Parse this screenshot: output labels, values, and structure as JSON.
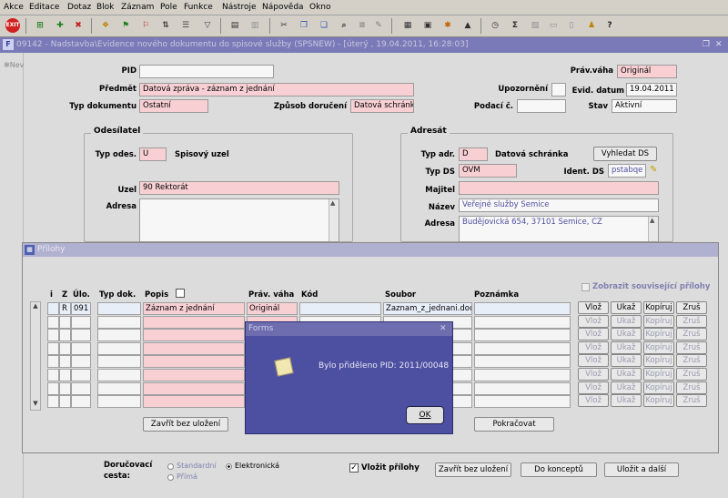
{
  "menu": [
    "Akce",
    "Editace",
    "Dotaz",
    "Blok",
    "Záznam",
    "Pole",
    "Funkce",
    "Nástroje",
    "Nápověda",
    "Okno"
  ],
  "window": {
    "title": "09142 - Nadstavba\\Evidence nového dokumentu do spisové služby (SPSNEW) - [úterý  , 19.04.2011, 16:28:03]"
  },
  "left_label": "Nev",
  "main": {
    "pid_label": "PID",
    "pid_value": "",
    "predmet_label": "Předmět",
    "predmet_value": "Datová zpráva - záznam z jednání",
    "typdok_label": "Typ dokumentu",
    "typdok_value": "Ostatní",
    "zpusob_label": "Způsob doručení",
    "zpusob_value": "Datová schránka",
    "prav_label": "Práv.váha",
    "prav_value": "Originál",
    "upoz_label": "Upozornění",
    "evid_label": "Evid. datum",
    "evid_value": "19.04.2011",
    "podaci_label": "Podací č.",
    "podaci_value": "",
    "stav_label": "Stav",
    "stav_value": "Aktivní"
  },
  "odesilatel": {
    "title": "Odesílatel",
    "typodes_label": "Typ odes.",
    "typodes_value": "U",
    "typodes_desc": "Spisový uzel",
    "uzel_label": "Uzel",
    "uzel_value": "90 Rektorát",
    "adresa_label": "Adresa",
    "adresa_value": ""
  },
  "adresat": {
    "title": "Adresát",
    "typadr_label": "Typ adr.",
    "typadr_value": "D",
    "typadr_desc": "Datová schránka",
    "vyhledat_label": "Vyhledat DS",
    "typds_label": "Typ DS",
    "typds_value": "OVM",
    "ident_label": "Ident. DS",
    "ident_value": "pstabqe",
    "majitel_label": "Majitel",
    "majitel_value": "",
    "nazev_label": "Název",
    "nazev_value": "Veřejné služby Semice",
    "adresa_label": "Adresa",
    "adresa_value": "Budějovická 654, 37101 Semice, CZ"
  },
  "prilohy": {
    "title": "Přílohy",
    "show_related": "Zobrazit související přílohy",
    "headers": {
      "i": "i",
      "z": "Z",
      "ulo": "Úlo.",
      "typdok": "Typ dok.",
      "popis": "Popis",
      "prav": "Práv. váha",
      "kod": "Kód",
      "soubor": "Soubor",
      "pozn": "Poznámka"
    },
    "rows": [
      {
        "i": "",
        "z": "R",
        "ulo": "091",
        "typdok": "",
        "popis": "Záznam z jednání",
        "prav": "Originál",
        "kod": "",
        "soubor": "Zaznam_z_jednani.doc",
        "pozn": ""
      }
    ],
    "row_buttons": [
      "Vlož",
      "Ukaž",
      "Kopíruj",
      "Zruš"
    ],
    "zavrit_label": "Zavřít bez uložení",
    "pokracovat_label": "Pokračovat"
  },
  "dialog": {
    "title": "Forms",
    "message": "Bylo přiděleno PID: 2011/00048",
    "ok_label": "OK"
  },
  "footer": {
    "dorucovaci_label": "Doručovací\ncesta:",
    "radio_standard": "Standardní",
    "radio_elektronicka": "Elektronická",
    "radio_prima": "Přímá",
    "vlozit_label": "Vložit přílohy",
    "zavrit_label": "Zavřít bez uložení",
    "koncept_label": "Do konceptů",
    "ulozit_label": "Uložit a další"
  },
  "colors": {
    "field_required": "#f8d0d4",
    "dialog_bg": "#4d4fa0",
    "title_bar": "#7a7ab8"
  }
}
